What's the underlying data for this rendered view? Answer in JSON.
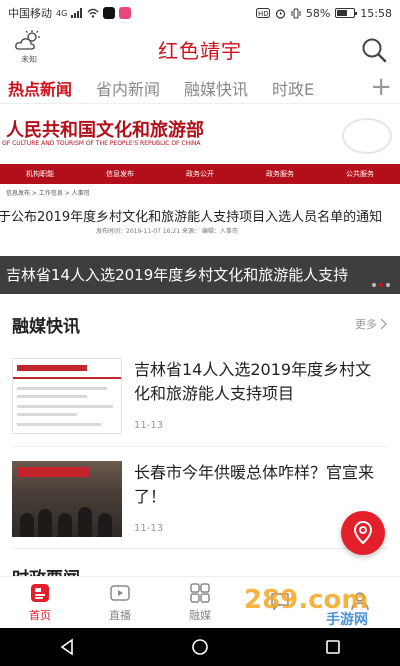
{
  "status_bar": {
    "carrier": "中国移动",
    "network": "4G",
    "battery": "58%",
    "time": "15:58"
  },
  "header": {
    "weather_label": "未知",
    "title": "红色靖宇"
  },
  "tabs": [
    {
      "label": "热点新闻",
      "active": true
    },
    {
      "label": "省内新闻",
      "active": false
    },
    {
      "label": "融媒快讯",
      "active": false
    },
    {
      "label": "时政E",
      "active": false
    }
  ],
  "banner": {
    "ministry_name": "人民共和国文化和旅游部",
    "ministry_en": "OF CULTURE AND TOURISM OF THE PEOPLE'S REPUBLIC OF CHINA",
    "nav": [
      "机构职能",
      "信息发布",
      "政务公开",
      "政务服务",
      "公共服务"
    ],
    "breadcrumb": "信息发布 > 工作信息 > 人事司",
    "headline": "于公布2019年度乡村文化和旅游能人支持项目入选人员名单的通知",
    "meta": "发布时间：2019-11-07 16:21    来源：    编辑：人事司",
    "caption": "吉林省14人入选2019年度乡村文化和旅游能人支持"
  },
  "section": {
    "title": "融媒快讯",
    "more": "更多"
  },
  "news": [
    {
      "title": "吉林省14人入选2019年度乡村文化和旅游能人支持项目",
      "date": "11-13",
      "thumb_text": "和国文化和旅游部"
    },
    {
      "title": "长春市今年供暖总体咋样？官宣来了！",
      "date": "11-13",
      "thumb_text": "市人民政府新闻发布会"
    }
  ],
  "peek_title": "时政要闻",
  "bottom_tabs": [
    {
      "label": "首页",
      "icon": "home-icon",
      "active": true
    },
    {
      "label": "直播",
      "icon": "live-icon",
      "active": false
    },
    {
      "label": "融媒",
      "icon": "grid-icon",
      "active": false
    },
    {
      "label": "",
      "icon": "chat-icon",
      "active": false
    },
    {
      "label": "",
      "icon": "user-icon",
      "active": false
    }
  ],
  "watermark": {
    "brand": "289.com",
    "sub": "手游网"
  },
  "colors": {
    "accent": "#d0111b",
    "fab": "#e3202a",
    "ministry_red": "#b30f1a"
  }
}
